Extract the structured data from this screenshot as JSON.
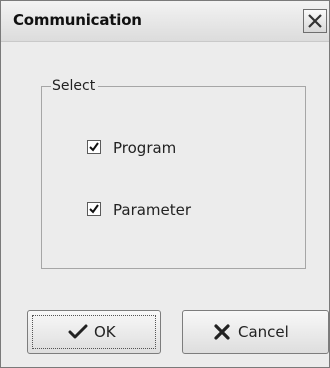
{
  "window": {
    "title": "Communication"
  },
  "group": {
    "label": "Select",
    "options": [
      {
        "label": "Program",
        "checked": true
      },
      {
        "label": "Parameter",
        "checked": true
      }
    ]
  },
  "buttons": {
    "ok": "OK",
    "cancel": "Cancel"
  },
  "icons": {
    "close": "close-icon",
    "checkbox_mark": "checkmark-icon",
    "ok": "checkmark-icon",
    "cancel": "x-icon"
  },
  "colors": {
    "dialog_bg": "#ececec",
    "border": "#7a7a7a",
    "text": "#222222"
  }
}
